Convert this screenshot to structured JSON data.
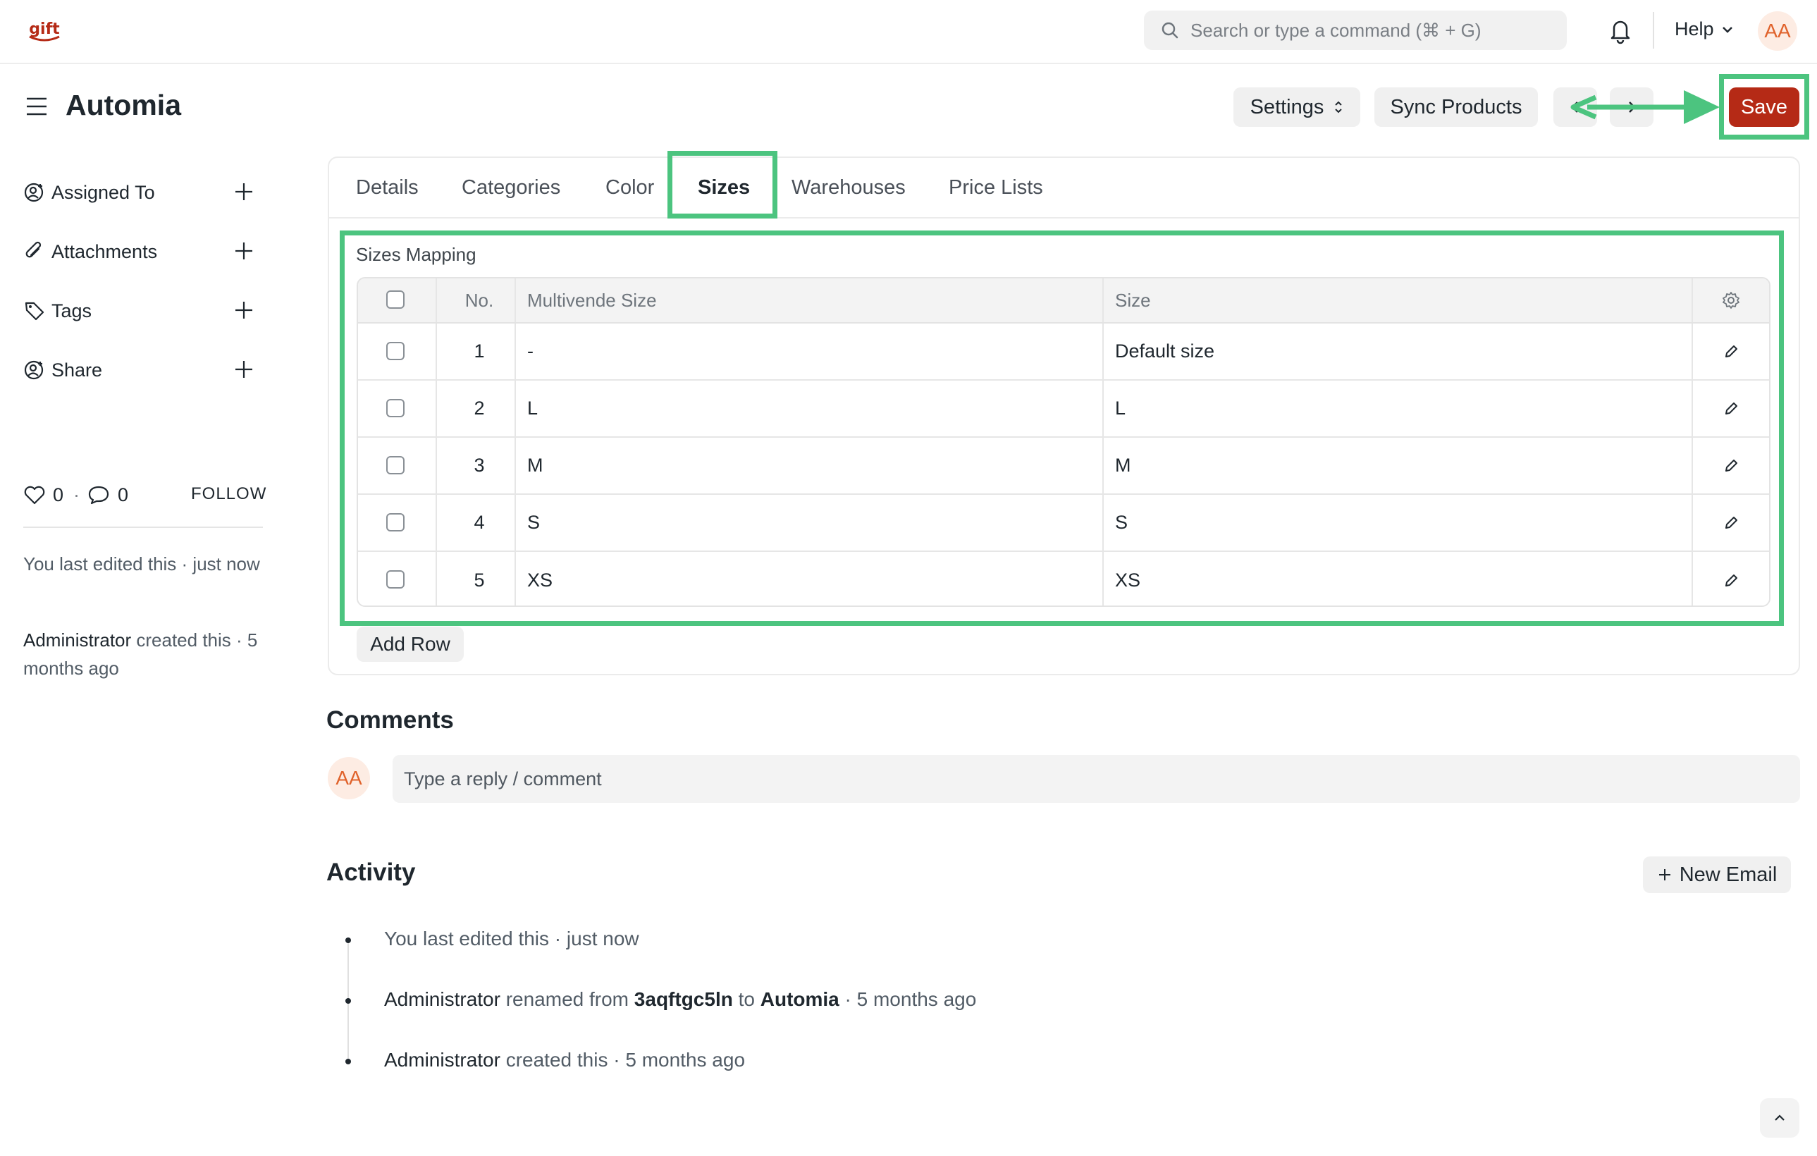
{
  "navbar": {
    "logo_text": "gift",
    "search_placeholder": "Search or type a command (⌘ + G)",
    "help_label": "Help",
    "avatar_initials": "AA"
  },
  "page": {
    "title": "Automia",
    "settings_label": "Settings",
    "sync_label": "Sync Products",
    "save_label": "Save"
  },
  "sidebar": {
    "items": [
      {
        "label": "Assigned To",
        "icon": "user-add-icon"
      },
      {
        "label": "Attachments",
        "icon": "paperclip-icon"
      },
      {
        "label": "Tags",
        "icon": "tag-icon"
      },
      {
        "label": "Share",
        "icon": "share-user-icon"
      }
    ],
    "likes_count": "0",
    "separator": "·",
    "comments_count": "0",
    "follow_label": "FOLLOW",
    "last_edit_prefix": "You last edited this · just now",
    "created_by": "Administrator",
    "created_suffix": " created this · 5 months ago"
  },
  "tabs": [
    {
      "label": "Details"
    },
    {
      "label": "Categories"
    },
    {
      "label": "Color"
    },
    {
      "label": "Sizes",
      "active": true
    },
    {
      "label": "Warehouses"
    },
    {
      "label": "Price Lists"
    }
  ],
  "sizes_table": {
    "section_label": "Sizes Mapping",
    "columns": {
      "no": "No.",
      "multivende": "Multivende Size",
      "size": "Size"
    },
    "rows": [
      {
        "no": "1",
        "multivende": "-",
        "size": "Default size"
      },
      {
        "no": "2",
        "multivende": "L",
        "size": "L"
      },
      {
        "no": "3",
        "multivende": "M",
        "size": "M"
      },
      {
        "no": "4",
        "multivende": "S",
        "size": "S"
      },
      {
        "no": "5",
        "multivende": "XS",
        "size": "XS"
      }
    ],
    "add_row_label": "Add Row"
  },
  "comments": {
    "heading": "Comments",
    "avatar_initials": "AA",
    "placeholder": "Type a reply / comment"
  },
  "activity": {
    "heading": "Activity",
    "new_email_label": "New Email",
    "items": [
      {
        "text": "You last edited this · just now"
      },
      {
        "who": "Administrator",
        "pre": " renamed from ",
        "from": "3aqftgc5ln",
        "mid": " to ",
        "to": "Automia",
        "post": " · 5 months ago"
      },
      {
        "who": "Administrator",
        "post": " created this · 5 months ago"
      }
    ]
  },
  "colors": {
    "save": "#b52a16",
    "highlight": "#4cc47f",
    "avatar_bg": "#fdece3",
    "avatar_fg": "#e0622b"
  }
}
